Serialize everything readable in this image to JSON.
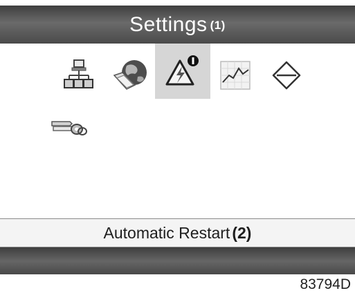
{
  "header": {
    "title": "Settings",
    "note": "(1)"
  },
  "menu": {
    "items": [
      {
        "icon": "network-icon",
        "selected": false
      },
      {
        "icon": "globe-folder-icon",
        "selected": false
      },
      {
        "icon": "automatic-restart-icon",
        "selected": true
      },
      {
        "icon": "chart-icon",
        "selected": false
      },
      {
        "icon": "diamond-icon",
        "selected": false
      },
      {
        "icon": "keys-icon",
        "selected": false
      }
    ]
  },
  "status": {
    "label": "Automatic Restart",
    "note": "(2)"
  },
  "footer": {
    "reference": "83794D"
  }
}
